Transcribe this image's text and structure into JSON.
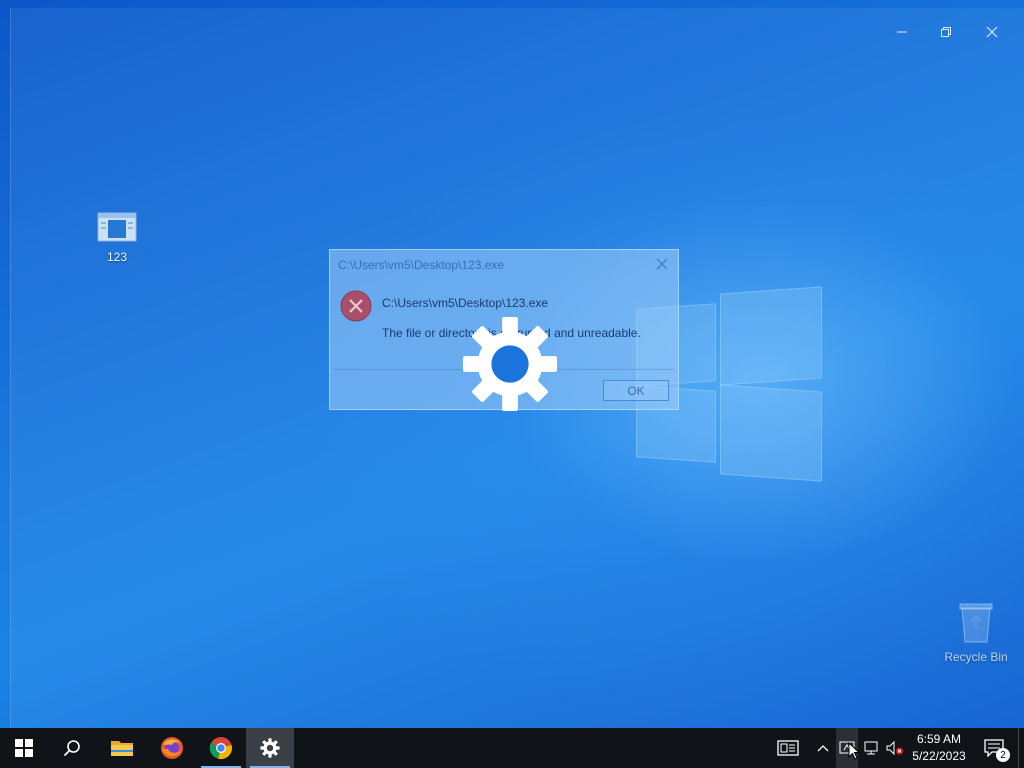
{
  "desktop": {
    "icons": [
      {
        "label": "123"
      },
      {
        "label": "Recycle Bin"
      }
    ]
  },
  "window": {
    "caption": {
      "minimize": "minimize-icon",
      "restore": "restore-icon",
      "close": "close-icon"
    }
  },
  "dialog": {
    "title": "C:\\Users\\vm5\\Desktop\\123.exe",
    "path": "C:\\Users\\vm5\\Desktop\\123.exe",
    "message": "The file or directory is corrupted and unreadable.",
    "ok_label": "OK",
    "icon": "error-icon"
  },
  "overlay": {
    "icon": "gear-icon"
  },
  "taskbar": {
    "buttons": [
      {
        "name": "start",
        "icon": "windows-logo-icon"
      },
      {
        "name": "search",
        "icon": "search-icon"
      },
      {
        "name": "file-explorer",
        "icon": "folder-icon"
      },
      {
        "name": "firefox",
        "icon": "firefox-icon"
      },
      {
        "name": "chrome",
        "icon": "chrome-icon"
      },
      {
        "name": "settings",
        "icon": "gear-icon",
        "active": true
      }
    ],
    "tray": {
      "time": "6:59 AM",
      "date": "5/22/2023",
      "notification_count": "2"
    }
  },
  "colors": {
    "taskbar": "#101418",
    "desktop_accent": "#0b5ccf",
    "error_red": "#c8314a"
  }
}
